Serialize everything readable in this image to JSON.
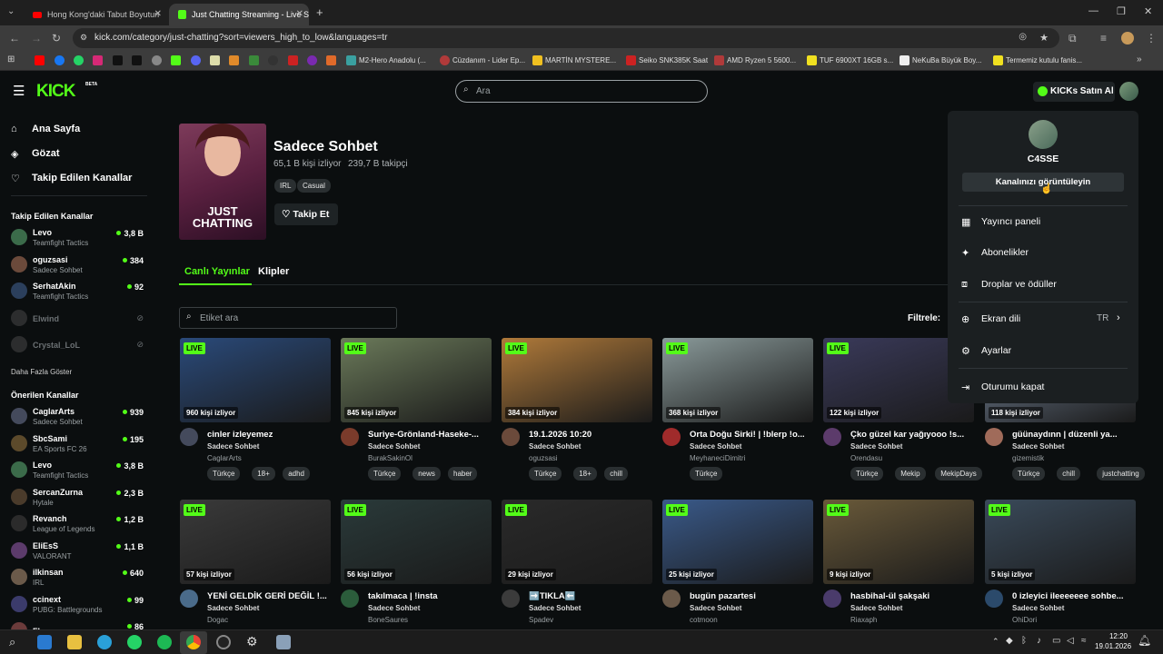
{
  "browser": {
    "tabs": [
      {
        "title": "Hong Kong'daki Tabut Boyutun",
        "active": false
      },
      {
        "title": "Just Chatting Streaming - Live S",
        "active": true
      }
    ],
    "url": "kick.com/category/just-chatting?sort=viewers_high_to_low&languages=tr",
    "bookmarks": [
      "M2-Hero Anadolu (...",
      "Cüzdanım - Lider Ep...",
      "MARTİN MYSTERE...",
      "Seiko SNK385K Saat",
      "AMD Ryzen 5 5600...",
      "TUF 6900XT 16GB s...",
      "NeKuBa Büyük Boy...",
      "Termemiz kutulu fanis..."
    ]
  },
  "header": {
    "logo": "KICK",
    "logo_badge": "BETA",
    "search_placeholder": "Ara",
    "kicks_button": "KICKs Satın Al"
  },
  "sidebar": {
    "nav": [
      {
        "label": "Ana Sayfa",
        "icon": "home-icon"
      },
      {
        "label": "Gözat",
        "icon": "compass-icon"
      },
      {
        "label": "Takip Edilen Kanallar",
        "icon": "heart-icon"
      }
    ],
    "followed_heading": "Takip Edilen Kanallar",
    "followed": [
      {
        "name": "Levo",
        "category": "Teamfight Tactics",
        "viewers": "3,8 B",
        "color": "#3b6b4a"
      },
      {
        "name": "oguzsasi",
        "category": "Sadece Sohbet",
        "viewers": "384",
        "color": "#6b4a3b"
      },
      {
        "name": "SerhatAkin",
        "category": "Teamfight Tactics",
        "viewers": "92",
        "color": "#2b3f5c"
      },
      {
        "name": "Elwind",
        "category": "",
        "viewers": "",
        "color": "#555555"
      },
      {
        "name": "Crystal_LoL",
        "category": "",
        "viewers": "",
        "color": "#555555"
      }
    ],
    "show_more": "Daha Fazla Göster",
    "recommended_heading": "Önerilen Kanallar",
    "recommended": [
      {
        "name": "CaglarArts",
        "category": "Sadece Sohbet",
        "viewers": "939",
        "color": "#444a5c"
      },
      {
        "name": "SbcSami",
        "category": "EA Sports FC 26",
        "viewers": "195",
        "color": "#5c4a2b"
      },
      {
        "name": "Levo",
        "category": "Teamfight Tactics",
        "viewers": "3,8 B",
        "color": "#3b6b4a"
      },
      {
        "name": "SercanZurna",
        "category": "Hytale",
        "viewers": "2,3 B",
        "color": "#4a3b2b"
      },
      {
        "name": "Revanch",
        "category": "League of Legends",
        "viewers": "1,2 B",
        "color": "#2b2b2b"
      },
      {
        "name": "EliEsS",
        "category": "VALORANT",
        "viewers": "1,1 B",
        "color": "#5c3b6b"
      },
      {
        "name": "ilkinsan",
        "category": "IRL",
        "viewers": "640",
        "color": "#6b5a4a"
      },
      {
        "name": "ccinext",
        "category": "PUBG: Battlegrounds",
        "viewers": "99",
        "color": "#3b3b6b"
      },
      {
        "name": "Flomore",
        "category": "",
        "viewers": "86",
        "color": "#6b3b3b"
      }
    ]
  },
  "category": {
    "title": "Sadece Sohbet",
    "viewers": "65,1 B kişi izliyor",
    "followers": "239,7 B takipçi",
    "tags": [
      "IRL",
      "Casual"
    ],
    "follow_button": "Takip Et",
    "image_text": "JUST\nCHATTING",
    "tabs": [
      "Canlı Yayınlar",
      "Klipler"
    ],
    "tag_search_placeholder": "Etiket ara",
    "filter_label": "Filtrele:"
  },
  "streams": [
    {
      "title": "cinler izleyemez",
      "category": "Sadece Sohbet",
      "user": "CaglarArts",
      "viewers": "960 kişi izliyor",
      "tags": [
        "Türkçe",
        "18+",
        "adhd"
      ],
      "thumb": "#2a4a7a",
      "av": "#444a5c"
    },
    {
      "title": "Suriye-Grönland-Haseke-...",
      "category": "Sadece Sohbet",
      "user": "BurakSakinOl",
      "viewers": "845 kişi izliyor",
      "tags": [
        "Türkçe",
        "news",
        "haber"
      ],
      "thumb": "#6b7a5a",
      "av": "#7a3b2b"
    },
    {
      "title": "19.1.2026 10:20",
      "category": "Sadece Sohbet",
      "user": "oguzsasi",
      "viewers": "384 kişi izliyor",
      "tags": [
        "Türkçe",
        "18+",
        "chill"
      ],
      "thumb": "#b07a3a",
      "av": "#6b4a3b"
    },
    {
      "title": "Orta Doğu Sirki! | !blerp !o...",
      "category": "Sadece Sohbet",
      "user": "MeyhaneciDimitri",
      "viewers": "368 kişi izliyor",
      "tags": [
        "Türkçe"
      ],
      "thumb": "#8a9a9a",
      "av": "#a02b2b"
    },
    {
      "title": "Çko güzel kar yağıyooo !s...",
      "category": "Sadece Sohbet",
      "user": "Orendasu",
      "viewers": "122 kişi izliyor",
      "tags": [
        "Türkçe",
        "Mekip",
        "MekipDays"
      ],
      "thumb": "#3a3a5a",
      "av": "#5c3b6b"
    },
    {
      "title": "güünaydınn | düzenli ya...",
      "category": "Sadece Sohbet",
      "user": "gizemistik",
      "viewers": "118 kişi izliyor",
      "tags": [
        "Türkçe",
        "chill",
        "justchatting"
      ],
      "thumb": "#7a8aa0",
      "av": "#a06b5a"
    },
    {
      "title": "YENİ GELDİK GERİ DEĞİL !...",
      "category": "Sadece Sohbet",
      "user": "Dogac",
      "viewers": "57 kişi izliyor",
      "tags": [],
      "thumb": "#3a3a3a",
      "av": "#4a6b8a"
    },
    {
      "title": "takılmaca | !insta",
      "category": "Sadece Sohbet",
      "user": "BoneSaures",
      "viewers": "56 kişi izliyor",
      "tags": [],
      "thumb": "#2a3a3a",
      "av": "#2b5c3b"
    },
    {
      "title": "➡️TIKLA⬅️",
      "category": "Sadece Sohbet",
      "user": "Spadev",
      "viewers": "29 kişi izliyor",
      "tags": [],
      "thumb": "#2a2a2a",
      "av": "#3b3b3b"
    },
    {
      "title": "bugün pazartesi",
      "category": "Sadece Sohbet",
      "user": "cotmoon",
      "viewers": "25 kişi izliyor",
      "tags": [],
      "thumb": "#3a5a8a",
      "av": "#6b5a4a"
    },
    {
      "title": "hasbihal-ül şakşaki",
      "category": "Sadece Sohbet",
      "user": "Riaxaph",
      "viewers": "9 kişi izliyor",
      "tags": [],
      "thumb": "#6a5a3a",
      "av": "#4a3b6b"
    },
    {
      "title": "0 izleyici ileeeeeee sohbe...",
      "category": "Sadece Sohbet",
      "user": "OhiDori",
      "viewers": "5 kişi izliyor",
      "tags": [],
      "thumb": "#3a4a5a",
      "av": "#2b4a6b"
    }
  ],
  "dropdown": {
    "username": "C4SSE",
    "view_channel": "Kanalınızı görüntüleyin",
    "items": [
      {
        "label": "Yayıncı paneli",
        "icon": "dashboard-icon"
      },
      {
        "label": "Abonelikler",
        "icon": "sparkle-icon"
      },
      {
        "label": "Droplar ve ödüller",
        "icon": "gift-icon"
      },
      {
        "label": "Ekran dili",
        "icon": "globe-icon",
        "value": "TR"
      },
      {
        "label": "Ayarlar",
        "icon": "gear-icon"
      },
      {
        "label": "Oturumu kapat",
        "icon": "logout-icon"
      }
    ]
  },
  "taskbar": {
    "time": "12:20",
    "date": "19.01.2026"
  }
}
